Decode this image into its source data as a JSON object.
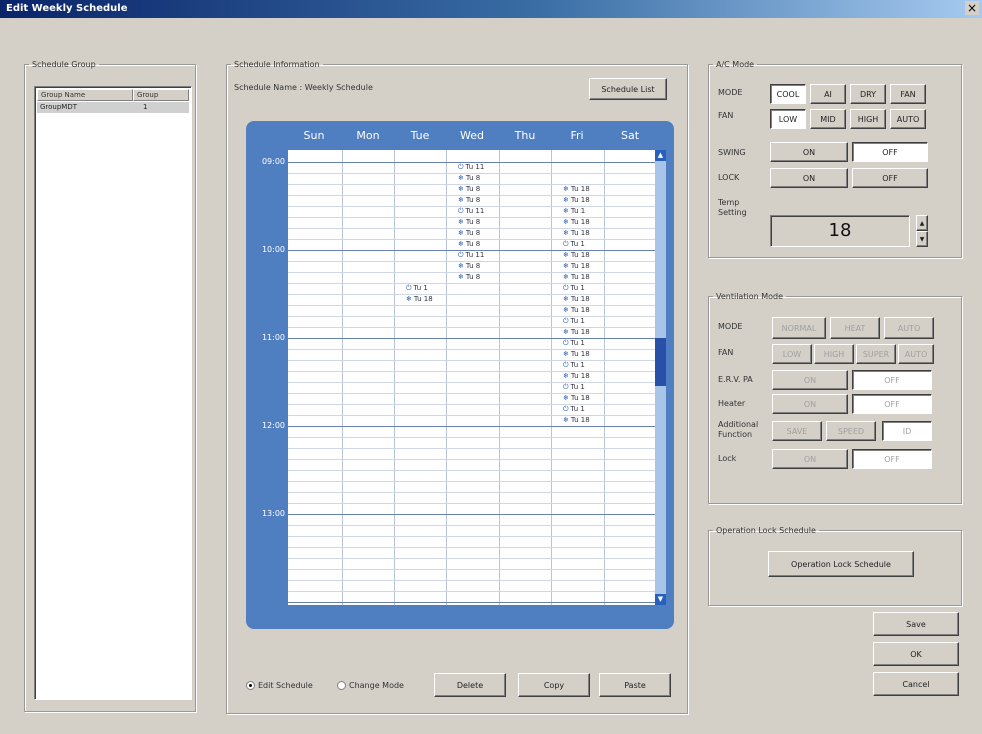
{
  "window": {
    "title": "Edit Weekly Schedule",
    "close": "×"
  },
  "schedule_group": {
    "legend": "Schedule Group",
    "columns": [
      "Group Name",
      "Group"
    ],
    "rows": [
      {
        "name": "GroupMDT",
        "group": "1"
      }
    ]
  },
  "schedule_info": {
    "legend": "Schedule Information",
    "name_label": "Schedule Name :  Weekly Schedule",
    "schedule_list_button": "Schedule List",
    "days": [
      "Sun",
      "Mon",
      "Tue",
      "Wed",
      "Thu",
      "Fri",
      "Sat"
    ],
    "times": [
      "09:00",
      "10:00",
      "11:00",
      "12:00",
      "13:00"
    ],
    "events": [
      {
        "day": 3,
        "slot": 1,
        "icon": "⏻",
        "text": "Tu 11"
      },
      {
        "day": 3,
        "slot": 2,
        "icon": "❄",
        "text": "Tu  8"
      },
      {
        "day": 3,
        "slot": 3,
        "icon": "❄",
        "text": "Tu  8"
      },
      {
        "day": 3,
        "slot": 4,
        "icon": "❄",
        "text": "Tu  8"
      },
      {
        "day": 3,
        "slot": 5,
        "icon": "⏻",
        "text": "Tu 11"
      },
      {
        "day": 3,
        "slot": 6,
        "icon": "❄",
        "text": "Tu  8"
      },
      {
        "day": 3,
        "slot": 7,
        "icon": "❄",
        "text": "Tu  8"
      },
      {
        "day": 3,
        "slot": 8,
        "icon": "❄",
        "text": "Tu  8"
      },
      {
        "day": 3,
        "slot": 9,
        "icon": "⏻",
        "text": "Tu 11"
      },
      {
        "day": 3,
        "slot": 10,
        "icon": "❄",
        "text": "Tu  8"
      },
      {
        "day": 3,
        "slot": 11,
        "icon": "❄",
        "text": "Tu  8"
      },
      {
        "day": 2,
        "slot": 12,
        "icon": "⏻",
        "text": "Tu 1"
      },
      {
        "day": 2,
        "slot": 13,
        "icon": "❄",
        "text": "Tu 18"
      },
      {
        "day": 5,
        "slot": 3,
        "icon": "❄",
        "text": "Tu 18"
      },
      {
        "day": 5,
        "slot": 4,
        "icon": "❄",
        "text": "Tu 18"
      },
      {
        "day": 5,
        "slot": 5,
        "icon": "❄",
        "text": "Tu 1"
      },
      {
        "day": 5,
        "slot": 6,
        "icon": "❄",
        "text": "Tu 18"
      },
      {
        "day": 5,
        "slot": 7,
        "icon": "❄",
        "text": "Tu 18"
      },
      {
        "day": 5,
        "slot": 8,
        "icon": "⏻",
        "text": "Tu 1"
      },
      {
        "day": 5,
        "slot": 9,
        "icon": "❄",
        "text": "Tu 18"
      },
      {
        "day": 5,
        "slot": 10,
        "icon": "❄",
        "text": "Tu 18"
      },
      {
        "day": 5,
        "slot": 11,
        "icon": "❄",
        "text": "Tu 18"
      },
      {
        "day": 5,
        "slot": 12,
        "icon": "⏻",
        "text": "Tu 1"
      },
      {
        "day": 5,
        "slot": 13,
        "icon": "❄",
        "text": "Tu 18"
      },
      {
        "day": 5,
        "slot": 14,
        "icon": "❄",
        "text": "Tu 18"
      },
      {
        "day": 5,
        "slot": 15,
        "icon": "⏻",
        "text": "Tu 1"
      },
      {
        "day": 5,
        "slot": 16,
        "icon": "❄",
        "text": "Tu 18"
      },
      {
        "day": 5,
        "slot": 17,
        "icon": "⏻",
        "text": "Tu 1"
      },
      {
        "day": 5,
        "slot": 18,
        "icon": "❄",
        "text": "Tu 18"
      },
      {
        "day": 5,
        "slot": 19,
        "icon": "⏻",
        "text": "Tu 1"
      },
      {
        "day": 5,
        "slot": 20,
        "icon": "❄",
        "text": "Tu 18"
      },
      {
        "day": 5,
        "slot": 21,
        "icon": "⏻",
        "text": "Tu 1"
      },
      {
        "day": 5,
        "slot": 22,
        "icon": "❄",
        "text": "Tu 18"
      },
      {
        "day": 5,
        "slot": 23,
        "icon": "⏻",
        "text": "Tu 1"
      },
      {
        "day": 5,
        "slot": 24,
        "icon": "❄",
        "text": "Tu 18"
      }
    ],
    "radio_1": "Edit Schedule",
    "radio_2": "Change Mode",
    "delete": "Delete",
    "copy": "Copy",
    "paste": "Paste"
  },
  "ac_mode": {
    "legend": "A/C Mode",
    "mode_label": "MODE",
    "modes": [
      "COOL",
      "AI",
      "DRY",
      "FAN"
    ],
    "fan_label": "FAN",
    "fans": [
      "LOW",
      "MID",
      "HIGH",
      "AUTO"
    ],
    "swing_label": "SWING",
    "lock_label": "LOCK",
    "on": "ON",
    "off": "OFF",
    "temp_label": "Temp Setting",
    "temp_value": "18",
    "spin_up": "▲",
    "spin_down": "▼"
  },
  "vent_mode": {
    "legend": "Ventilation Mode",
    "mode_label": "MODE",
    "modes": [
      "NORMAL",
      "HEAT",
      "AUTO"
    ],
    "fan_label": "FAN",
    "fans": [
      "LOW",
      "HIGH",
      "SUPER",
      "AUTO"
    ],
    "erv_label": "E.R.V. PA",
    "heater_label": "Heater",
    "aux_label": "Additional Function",
    "aux_buttons": [
      "SAVE",
      "SPEED",
      "ID"
    ],
    "lock_label": "Lock",
    "on": "ON",
    "off": "OFF"
  },
  "op_lock": {
    "legend": "Operation Lock Schedule",
    "button": "Operation Lock Schedule"
  },
  "footer": {
    "save": "Save",
    "ok": "OK",
    "cancel": "Cancel"
  }
}
